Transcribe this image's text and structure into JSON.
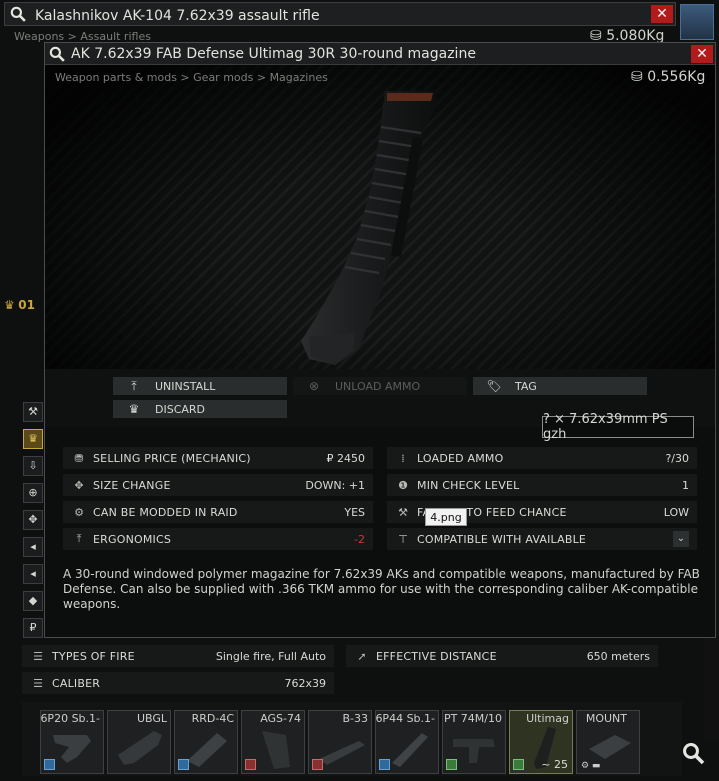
{
  "weapon_window": {
    "title": "Kalashnikov AK-104 7.62x39 assault rifle",
    "breadcrumb": "Weapons > Assault rifles",
    "weight": "5.080Kg",
    "gold_label": "01",
    "stats": [
      {
        "label": "TYPES OF FIRE",
        "value": "Single fire, Full Auto",
        "icon": "fire-mode-icon"
      },
      {
        "label": "EFFECTIVE DISTANCE",
        "value": "650 meters",
        "icon": "distance-icon"
      },
      {
        "label": "CALIBER",
        "value": "762x39",
        "icon": "caliber-icon"
      }
    ],
    "mods": [
      {
        "name": "6P20 Sb.1-",
        "icon": "muzzle-brake-icon"
      },
      {
        "name": "UBGL",
        "icon": "grenade-launcher-mount-icon"
      },
      {
        "name": "RRD-4C",
        "icon": "muzzle-device-icon"
      },
      {
        "name": "AGS-74",
        "icon": "pistol-grip-icon"
      },
      {
        "name": "B-33",
        "icon": "dust-cover-icon"
      },
      {
        "name": "6P44 Sb.1-",
        "icon": "gas-tube-icon"
      },
      {
        "name": "PT 74M/10",
        "icon": "stock-icon"
      },
      {
        "name": "Ultimag",
        "icon": "magazine-icon",
        "count": "~ 25"
      },
      {
        "name": "MOUNT",
        "icon": "rail-mount-icon"
      }
    ]
  },
  "magazine_window": {
    "title": "AK 7.62x39 FAB Defense Ultimag 30R 30-round magazine",
    "breadcrumb": "Weapon parts & mods > Gear mods > Magazines",
    "weight": "0.556Kg",
    "actions": {
      "uninstall": "UNINSTALL",
      "unload_ammo": "UNLOAD AMMO",
      "tag": "TAG",
      "discard": "DISCARD"
    },
    "ammo_box": "? × 7.62x39mm PS gzh",
    "stats_left": [
      {
        "label": "SELLING PRICE (MECHANIC)",
        "value": "₽ 2450",
        "icon": "price-icon"
      },
      {
        "label": "SIZE CHANGE",
        "value": "DOWN: +1",
        "icon": "size-change-icon"
      },
      {
        "label": "CAN BE MODDED IN RAID",
        "value": "YES",
        "icon": "modding-icon"
      },
      {
        "label": "ERGONOMICS",
        "value": "-2",
        "icon": "ergonomics-icon"
      }
    ],
    "stats_right": [
      {
        "label": "LOADED AMMO",
        "value": "?/30",
        "icon": "loaded-ammo-icon"
      },
      {
        "label": "MIN CHECK LEVEL",
        "value": "1",
        "icon": "info-icon"
      },
      {
        "label": "FAILURE TO FEED CHANCE",
        "value": "LOW",
        "icon": "feed-chance-icon"
      },
      {
        "label": "COMPATIBLE WITH AVAILABLE",
        "value": "",
        "icon": "compatible-icon"
      }
    ],
    "tooltip": "4.png",
    "description": "A 30-round windowed polymer magazine for 7.62x39 AKs and compatible weapons, manufactured by FAB Defense. Can also be supplied with .366 TKM ammo for use with the corresponding caliber AK-compatible weapons."
  },
  "colors": {
    "close_red": "#b31b1b",
    "negative_stat": "#c83a2a",
    "gold": "#c9a53a",
    "active_mod": "#2f3322"
  }
}
